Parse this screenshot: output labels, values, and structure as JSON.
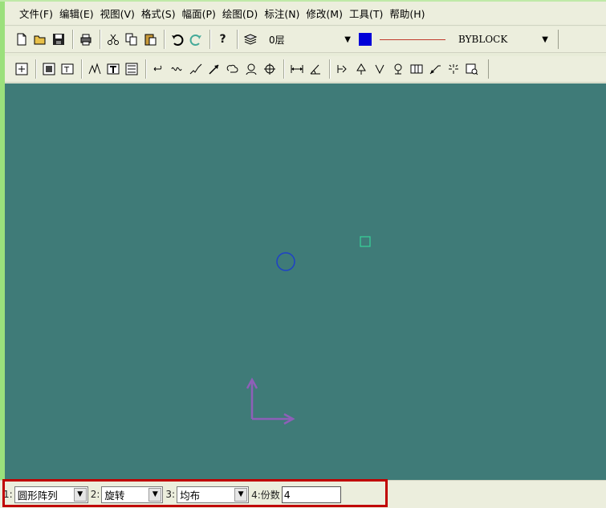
{
  "menu": [
    "文件(F)",
    "编辑(E)",
    "视图(V)",
    "格式(S)",
    "幅面(P)",
    "绘图(D)",
    "标注(N)",
    "修改(M)",
    "工具(T)",
    "帮助(H)"
  ],
  "toolbar1": {
    "layer_value": "0层",
    "linewidth_value": "BYBLOCK",
    "color_swatch": "#0000d8",
    "linetype_color": "#c0392b"
  },
  "icons": {
    "toolbar1": [
      "new-file-icon",
      "open-folder-icon",
      "save-icon",
      "print-icon",
      "cut-icon",
      "copy-icon",
      "paste-icon",
      "undo-icon",
      "redo-icon",
      "help-icon",
      "layer-manager-icon"
    ],
    "toolbar2": [
      "zoom-extents-icon",
      "zoom-window-icon",
      "text-style-icon",
      "polyline-text-icon",
      "multiline-text-icon",
      "block-insert-icon",
      "arc-icon",
      "wave-curve-icon",
      "zigzag-icon",
      "arrow-pointer-icon",
      "cloud-curve-icon",
      "hatch-icon",
      "cross-mark-icon",
      "dimension-linear-icon",
      "dimension-angular-icon",
      "weld-symbol-icon",
      "surface-symbol-icon",
      "tolerance-icon",
      "datum-icon",
      "rough-symbol-icon",
      "leader-icon",
      "balloon-icon",
      "inquiry-icon"
    ]
  },
  "canvas": {
    "background": "#3f7b78",
    "circle_color": "#1e40c8",
    "marker_color": "#38d49a",
    "axis_color": "#8e5fb8"
  },
  "command_bar": {
    "label1": "1:",
    "select1_value": "圆形阵列",
    "label2": "2:",
    "select2_value": "旋转",
    "label3": "3:",
    "select3_value": "均布",
    "label4": "4:份数",
    "count_value": "4"
  }
}
